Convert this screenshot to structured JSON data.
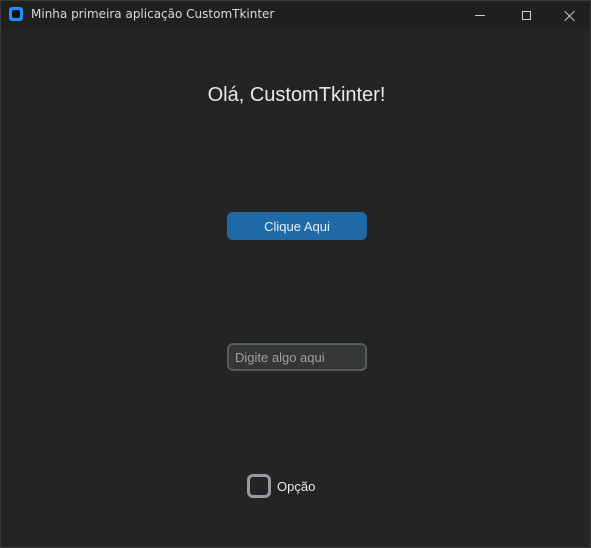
{
  "window": {
    "title": "Minha primeira aplicação CustomTkinter",
    "icon": "app-icon",
    "controls": {
      "minimize_icon": "minimize-icon",
      "maximize_icon": "maximize-icon",
      "close_icon": "close-icon"
    }
  },
  "main": {
    "greeting": "Olá, CustomTkinter!",
    "button_label": "Clique Aqui",
    "entry": {
      "placeholder": "Digite algo aqui",
      "value": ""
    },
    "checkbox": {
      "label": "Opção",
      "checked": false
    }
  },
  "colors": {
    "background": "#242424",
    "titlebar": "#202020",
    "accent_button": "#1f6aa5",
    "entry_bg": "#343638",
    "entry_border": "#565b5e",
    "checkbox_border": "#949a9f"
  }
}
